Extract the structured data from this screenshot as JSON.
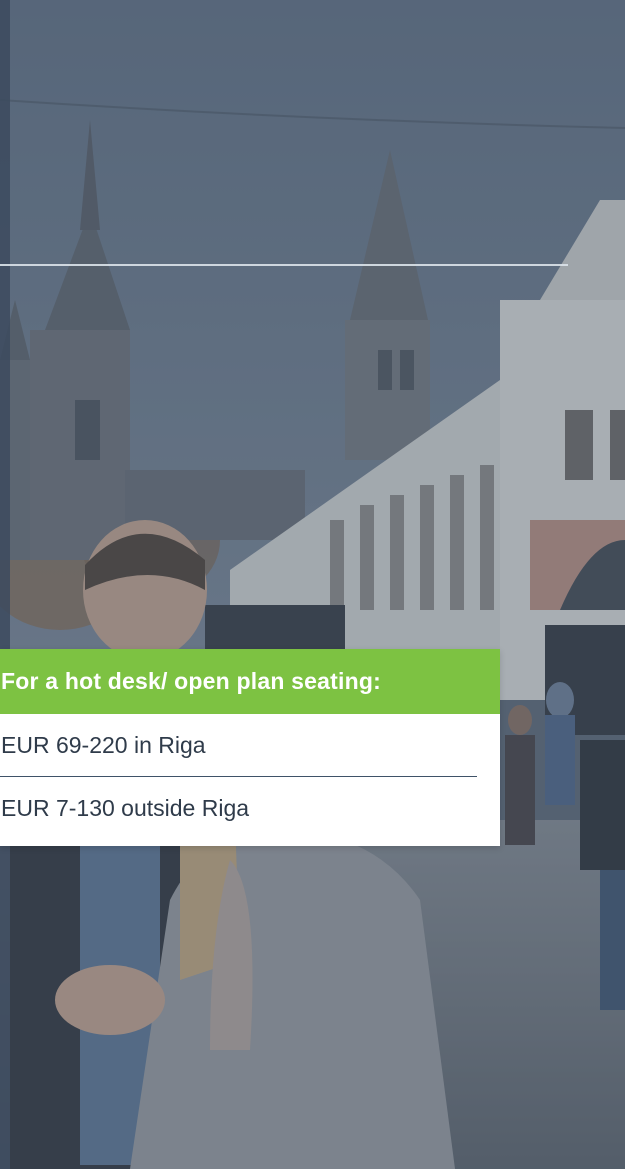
{
  "hot_desk_card": {
    "title": "For a hot desk/ open plan seating:",
    "prices": [
      "EUR 69-220 in Riga",
      "EUR 7-130 outside Riga"
    ],
    "header_color": "#7dc242"
  },
  "background": {
    "description_icon": "city-street-photo",
    "tint_color": "#4a5c74"
  }
}
